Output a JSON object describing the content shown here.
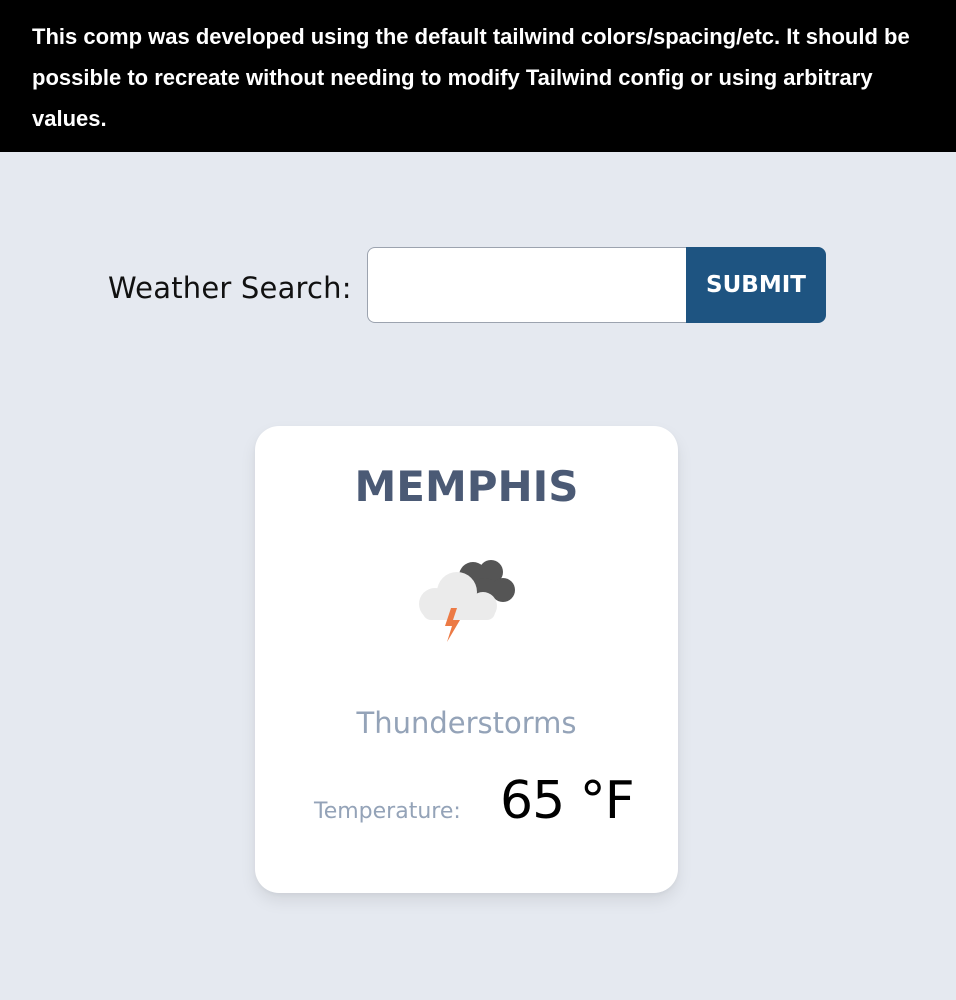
{
  "banner": {
    "text": "This comp was developed using the default tailwind colors/spacing/etc. It should be possible to recreate without needing to modify Tailwind config or using arbitrary values."
  },
  "search": {
    "label": "Weather Search:",
    "value": "",
    "placeholder": "",
    "submit_label": "SUBMIT"
  },
  "weather": {
    "city": "MEMPHIS",
    "icon": "thunderstorm-icon",
    "condition": "Thunderstorms",
    "temperature_label": "Temperature:",
    "temperature": "65 °F"
  },
  "colors": {
    "page_background": "#e5e9f0",
    "banner_background": "#000000",
    "button": "#1e5481",
    "city_text": "#4b5a75",
    "muted_text": "#94a3b8"
  }
}
